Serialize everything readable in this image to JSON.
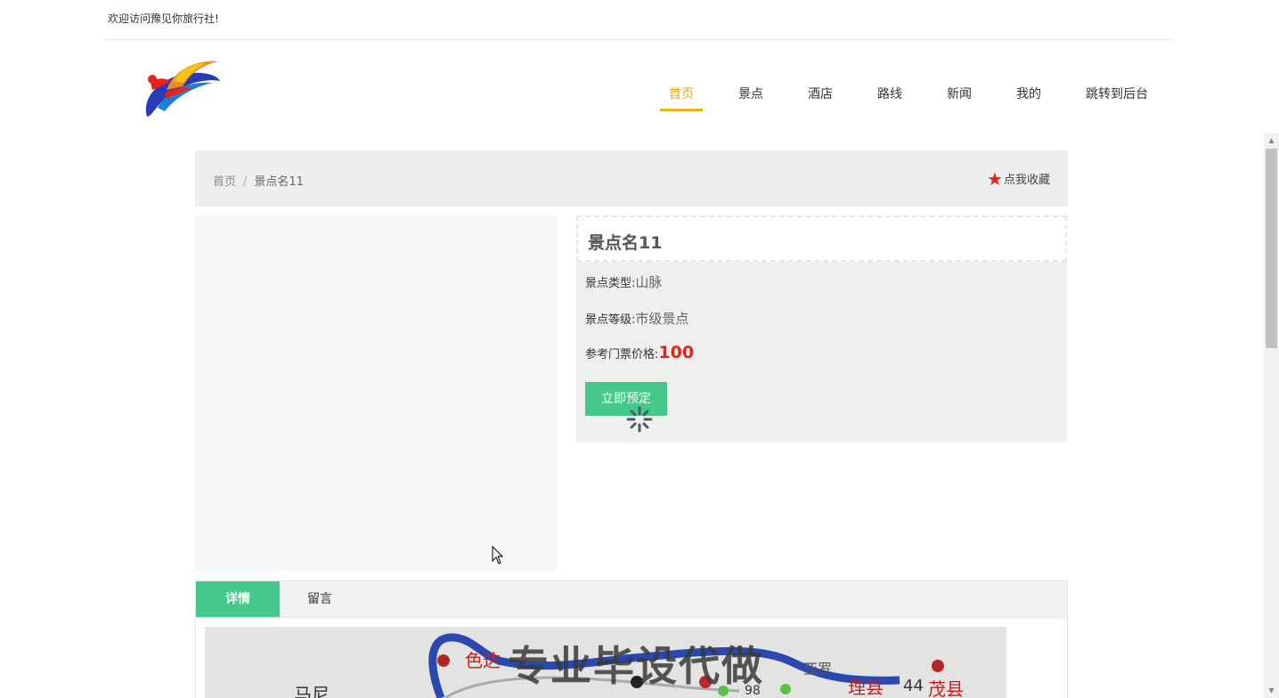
{
  "topbar": {
    "welcome": "欢迎访问豫见你旅行社!"
  },
  "nav": {
    "items": [
      {
        "label": "首页",
        "active": true
      },
      {
        "label": "景点"
      },
      {
        "label": "酒店"
      },
      {
        "label": "路线"
      },
      {
        "label": "新闻"
      },
      {
        "label": "我的"
      },
      {
        "label": "跳转到后台"
      }
    ]
  },
  "breadcrumb": {
    "home": "首页",
    "separator": "/",
    "current": "景点名11",
    "favorite": "点我收藏"
  },
  "spot": {
    "name": "景点名11",
    "type_label": "景点类型:",
    "type_value": "山脉",
    "level_label": "景点等级:",
    "level_value": "市级景点",
    "price_label": "参考门票价格:",
    "price_value": "100",
    "book_button": "立即预定"
  },
  "tabs": [
    {
      "label": "详情"
    },
    {
      "label": "留言"
    }
  ],
  "detail_image": {
    "watermark": "专业毕设代做",
    "labels": [
      "色达",
      "马尼",
      "理县",
      "44",
      "茂县",
      "亚罗",
      "98"
    ]
  },
  "colors": {
    "accent_green": "#45c98a",
    "nav_active": "#e6a817",
    "price_red": "#e1231a",
    "star_red": "#e1231a"
  }
}
